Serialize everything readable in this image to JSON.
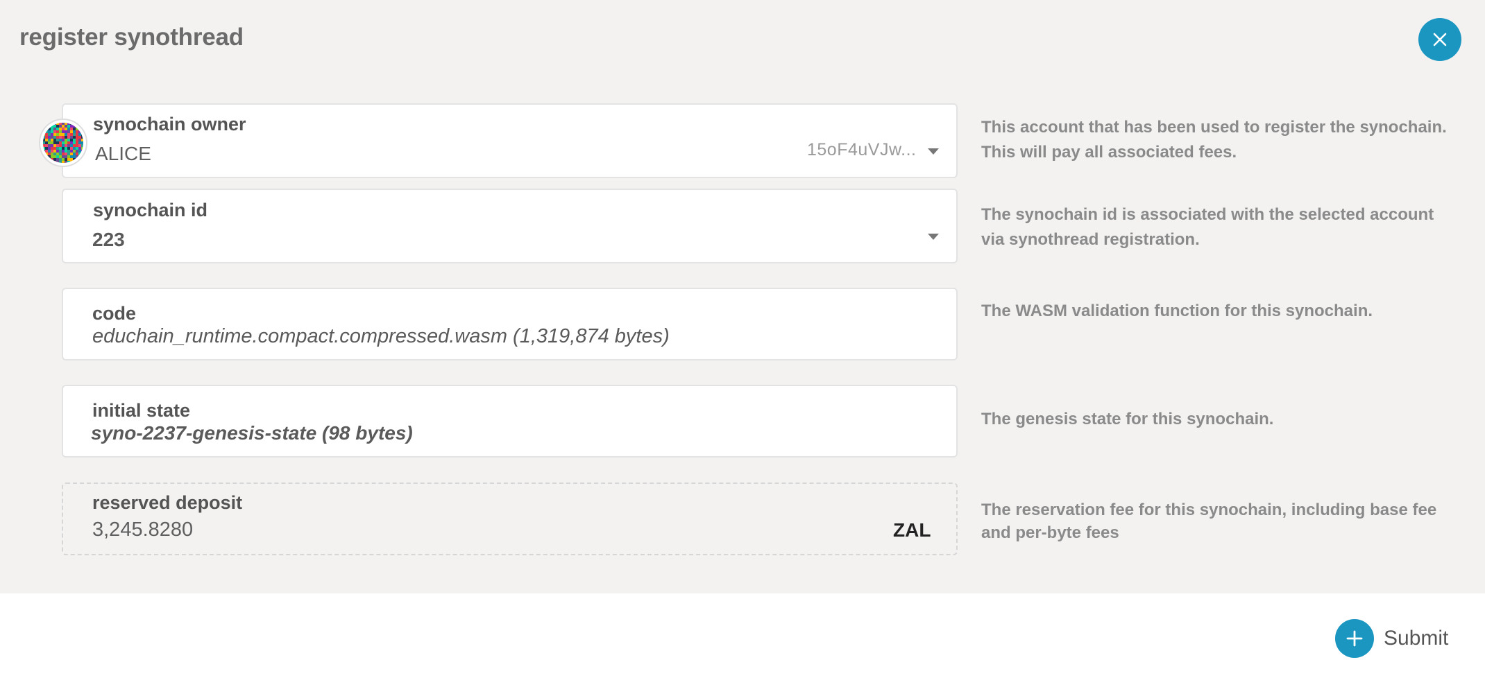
{
  "modal": {
    "title": "register synothread",
    "close_icon": "close-icon",
    "accent_color": "#1a96c1"
  },
  "owner": {
    "label": "synochain owner",
    "name": "ALICE",
    "address": "15oF4uVJw...",
    "avatar_icon": "identicon",
    "help": [
      "This account that has been used to register the  synochain.",
      "This will pay all associated fees."
    ]
  },
  "synochain_id": {
    "label": "synochain id",
    "value": "223",
    "help": [
      "The synochain id is associated with the selected account",
      "via synothread registration."
    ]
  },
  "code": {
    "label": "code",
    "value": "educhain_runtime.compact.compressed.wasm (1,319,874 bytes)",
    "help": [
      "The WASM validation function for this synochain."
    ]
  },
  "initial_state": {
    "label": "initial state",
    "value": "syno-2237-genesis-state (98 bytes)",
    "help": [
      "The genesis state for this synochain."
    ]
  },
  "reserved_deposit": {
    "label": "reserved deposit",
    "value": "3,245.8280",
    "unit": "ZAL",
    "help": [
      "The reservation fee for this synochain, including base fee",
      "and per-byte fees"
    ]
  },
  "footer": {
    "submit_label": "Submit",
    "submit_icon": "plus-icon"
  }
}
